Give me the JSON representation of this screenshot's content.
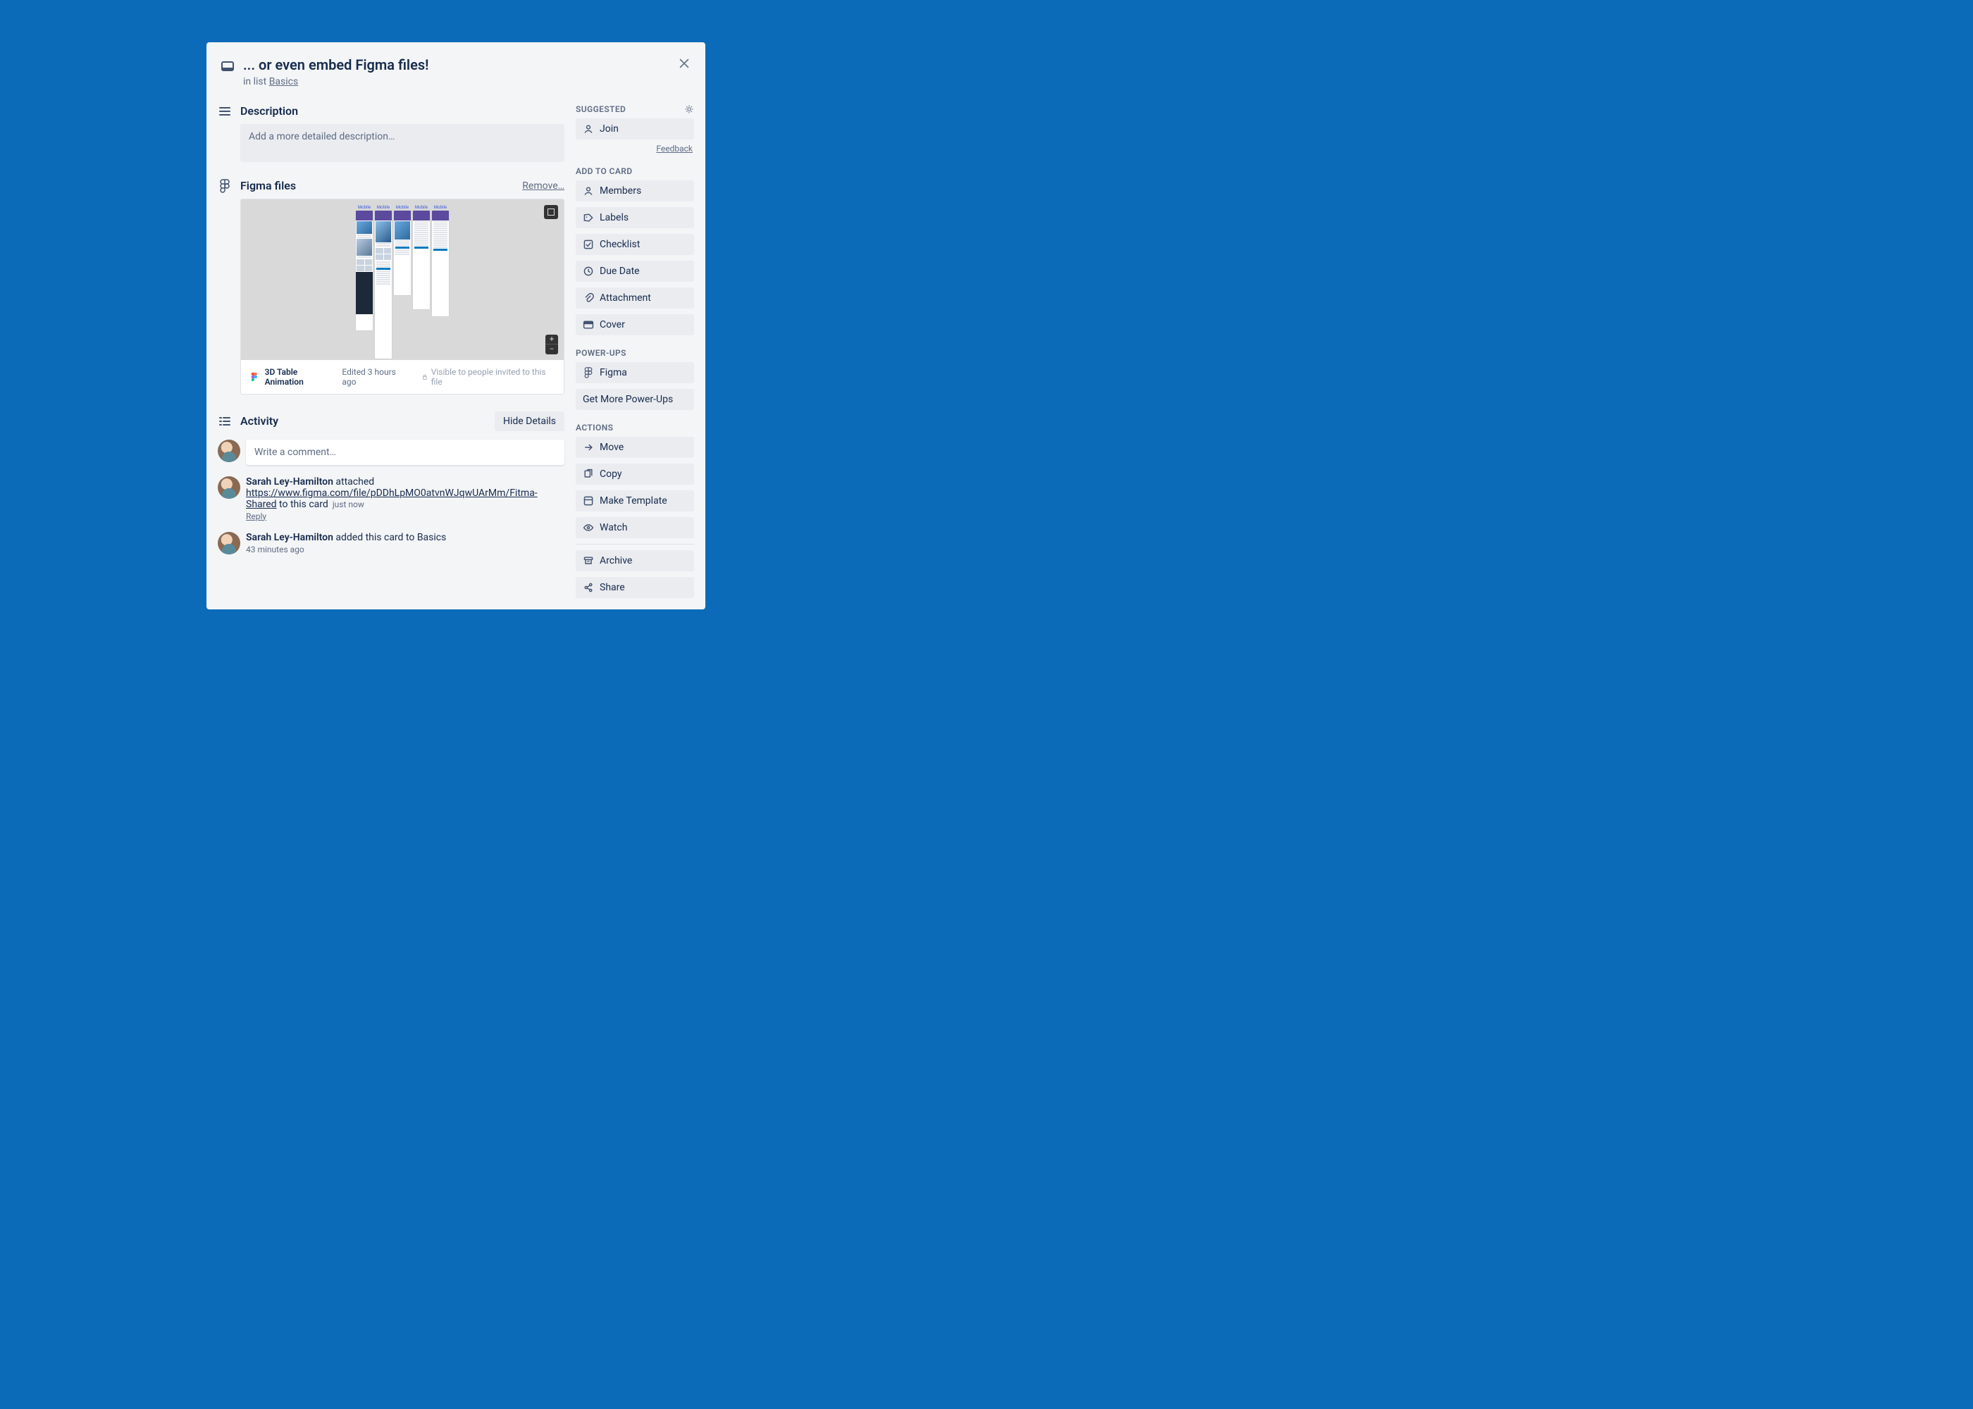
{
  "card": {
    "title": "... or even embed Figma files!",
    "in_list_prefix": "in list ",
    "list_name": "Basics"
  },
  "description": {
    "heading": "Description",
    "placeholder": "Add a more detailed description…"
  },
  "figma_section": {
    "heading": "Figma files",
    "remove_label": "Remove…",
    "file_name": "3D Table Animation",
    "edited": "Edited 3 hours ago",
    "visibility": "Visible to people invited to this file",
    "frame_labels": [
      "Mobile",
      "Mobile",
      "Mobile",
      "Mobile",
      "Mobile"
    ]
  },
  "activity": {
    "heading": "Activity",
    "hide_details": "Hide Details",
    "comment_placeholder": "Write a comment…",
    "items": [
      {
        "who": "Sarah Ley-Hamilton",
        "verb": " attached ",
        "link": "https://www.figma.com/file/pDDhLpMO0atvnWJqwUArMm/Fitma-Shared",
        "suffix": " to this card",
        "meta": "just now",
        "reply": "Reply"
      },
      {
        "who": "Sarah Ley-Hamilton",
        "verb": " added this card to Basics",
        "ts": "43 minutes ago"
      }
    ]
  },
  "sidebar": {
    "suggested": {
      "title": "Suggested",
      "join": "Join",
      "feedback": "Feedback"
    },
    "add_to_card": {
      "title": "Add to card",
      "members": "Members",
      "labels": "Labels",
      "checklist": "Checklist",
      "due_date": "Due Date",
      "attachment": "Attachment",
      "cover": "Cover"
    },
    "power_ups": {
      "title": "Power-Ups",
      "figma": "Figma",
      "get_more": "Get More Power-Ups"
    },
    "actions": {
      "title": "Actions",
      "move": "Move",
      "copy": "Copy",
      "make_template": "Make Template",
      "watch": "Watch",
      "archive": "Archive",
      "share": "Share"
    }
  }
}
